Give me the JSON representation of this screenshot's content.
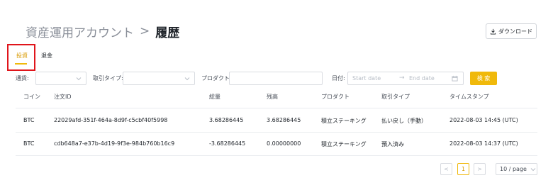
{
  "header": {
    "breadcrumb_parent": "資産運用アカウント",
    "breadcrumb_separator": ">",
    "breadcrumb_current": "履歴",
    "download_label": "ダウンロード",
    "download_icon": "download-icon"
  },
  "tabs": [
    {
      "label": "投資",
      "active": true
    },
    {
      "label": "退金",
      "active": false
    }
  ],
  "filters": {
    "coin_label": "通貨:",
    "type_label": "取引タイプ:",
    "product_label": "プロダクト:",
    "date_label": "日付:",
    "start_placeholder": "Start date",
    "date_arrow": "→",
    "end_placeholder": "End date",
    "search_label": "検 索"
  },
  "table": {
    "columns": [
      "コイン",
      "注文ID",
      "総量",
      "残高",
      "プロダクト",
      "取引タイプ",
      "タイムスタンプ"
    ],
    "rows": [
      {
        "coin": "BTC",
        "order_id": "22029afd-351f-464a-8d9f-c5cbf40f5998",
        "amount": "3.68286445",
        "balance": "3.68286445",
        "product": "積立ステーキング",
        "type": "払い戻し（手動）",
        "timestamp": "2022-08-03 14:45 (UTC)"
      },
      {
        "coin": "BTC",
        "order_id": "cdb648a7-e37b-4d19-9f3e-984b760b16c9",
        "amount": "-3.68286445",
        "balance": "0.00000000",
        "product": "積立ステーキング",
        "type": "預入済み",
        "timestamp": "2022-08-03 14:37 (UTC)"
      }
    ]
  },
  "pagination": {
    "prev": "<",
    "current_page": "1",
    "next": ">",
    "page_size": "10 / page"
  },
  "colors": {
    "accent": "#f0b90b",
    "highlight": "#e0151b"
  }
}
